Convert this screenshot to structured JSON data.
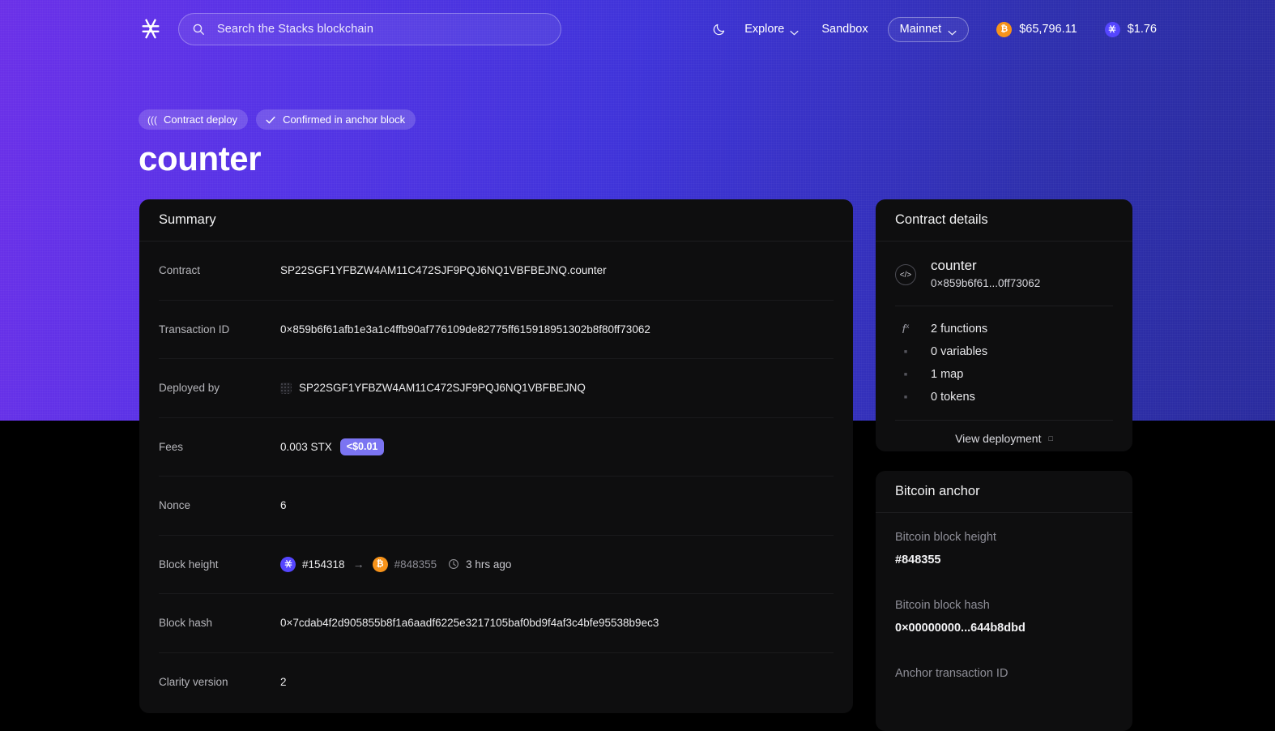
{
  "header": {
    "logo_icon": "stacks-logo-icon",
    "search": {
      "placeholder": "Search the Stacks blockchain",
      "icon": "search-icon"
    },
    "theme_toggle_icon": "moon-icon",
    "explore_label": "Explore",
    "sandbox_label": "Sandbox",
    "network_label": "Mainnet",
    "prices": [
      {
        "icon": "bitcoin-icon",
        "value": "$65,796.11"
      },
      {
        "icon": "stacks-icon",
        "value": "$1.76"
      }
    ]
  },
  "page": {
    "badges": [
      {
        "icon": "contract-deploy-icon",
        "label": "Contract deploy"
      },
      {
        "icon": "check-icon",
        "label": "Confirmed in anchor block"
      }
    ],
    "title": "counter"
  },
  "summary": {
    "heading": "Summary",
    "rows": [
      {
        "key": "Contract",
        "value": "SP22SGF1YFBZW4AM11C472SJF9PQJ6NQ1VBFBEJNQ.counter"
      },
      {
        "key": "Transaction ID",
        "value": "0×859b6f61afb1e3a1c4ffb90af776109de82775ff615918951302b8f80ff73062"
      },
      {
        "key": "Deployed by",
        "value": "SP22SGF1YFBZW4AM11C472SJF9PQJ6NQ1VBFBEJNQ"
      },
      {
        "key": "Fees",
        "value": "0.003 STX",
        "badge": "<$0.01"
      },
      {
        "key": "Nonce",
        "value": "6"
      },
      {
        "key": "Block height",
        "stx_block": "#154318",
        "btc_block": "#848355",
        "time_ago": "3 hrs ago"
      },
      {
        "key": "Block hash",
        "value": "0×7cdab4f2d905855b8f1a6aadf6225e3217105baf0bd9f4af3c4bfe95538b9ec3"
      },
      {
        "key": "Clarity version",
        "value": "2"
      }
    ]
  },
  "contract_details": {
    "heading": "Contract details",
    "name": "counter",
    "hash": "0×859b6f61...0ff73062",
    "stats": [
      {
        "icon": "function-icon",
        "label": "2 functions"
      },
      {
        "icon": "variable-icon",
        "label": "0 variables"
      },
      {
        "icon": "map-icon",
        "label": "1 map"
      },
      {
        "icon": "token-icon",
        "label": "0 tokens"
      }
    ],
    "view_deployment_label": "View deployment"
  },
  "bitcoin_anchor": {
    "heading": "Bitcoin anchor",
    "fields": [
      {
        "label": "Bitcoin block height",
        "value": "#848355"
      },
      {
        "label": "Bitcoin block hash",
        "value": "0×00000000...644b8dbd"
      },
      {
        "label": "Anchor transaction ID",
        "value": ""
      }
    ]
  },
  "colors": {
    "accent": "#5546ff",
    "bitcoin": "#f7931a",
    "badge": "#7b74f2",
    "card_bg": "#0e0e0f"
  }
}
